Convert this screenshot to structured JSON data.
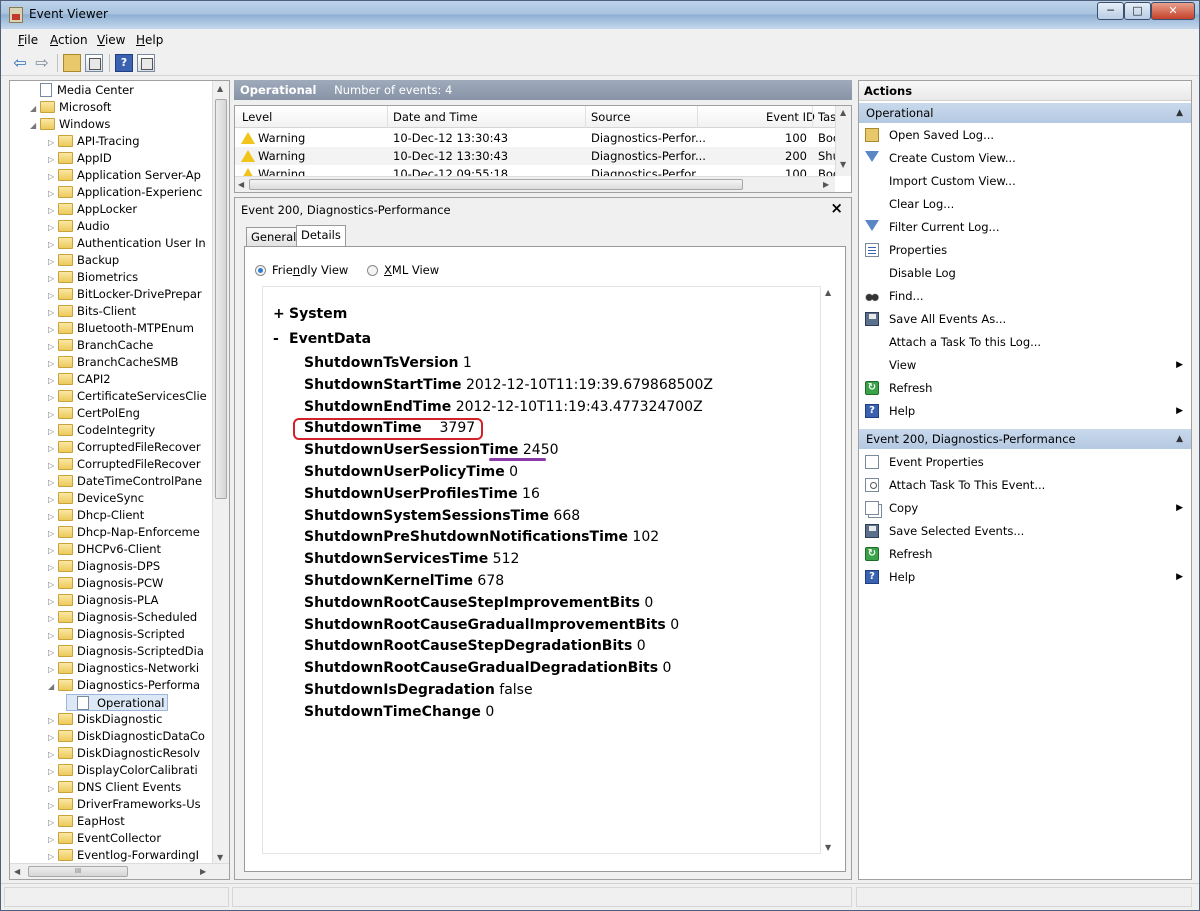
{
  "window": {
    "title": "Event Viewer",
    "min": "─",
    "max": "□",
    "close": "✕"
  },
  "menu": [
    {
      "underline": "F",
      "rest": "ile"
    },
    {
      "underline": "A",
      "rest": "ction"
    },
    {
      "underline": "V",
      "rest": "iew"
    },
    {
      "underline": "H",
      "rest": "elp"
    }
  ],
  "toolbar": {
    "back": "⇦",
    "forward": "⇨",
    "help": "?"
  },
  "tree": {
    "items": [
      {
        "label": "Media Center",
        "level": 0,
        "icon": "log",
        "expander": ""
      },
      {
        "label": "Microsoft",
        "level": 0,
        "icon": "folder",
        "expander": "◢"
      },
      {
        "label": "Windows",
        "level": 1,
        "icon": "folder",
        "expander": "◢"
      },
      {
        "label": "API-Tracing",
        "level": 2,
        "icon": "folder",
        "expander": "▷"
      },
      {
        "label": "AppID",
        "level": 2,
        "icon": "folder",
        "expander": "▷"
      },
      {
        "label": "Application Server-Ap",
        "level": 2,
        "icon": "folder",
        "expander": "▷"
      },
      {
        "label": "Application-Experienc",
        "level": 2,
        "icon": "folder",
        "expander": "▷"
      },
      {
        "label": "AppLocker",
        "level": 2,
        "icon": "folder",
        "expander": "▷"
      },
      {
        "label": "Audio",
        "level": 2,
        "icon": "folder",
        "expander": "▷"
      },
      {
        "label": "Authentication User In",
        "level": 2,
        "icon": "folder",
        "expander": "▷"
      },
      {
        "label": "Backup",
        "level": 2,
        "icon": "folder",
        "expander": "▷"
      },
      {
        "label": "Biometrics",
        "level": 2,
        "icon": "folder",
        "expander": "▷"
      },
      {
        "label": "BitLocker-DrivePrepar",
        "level": 2,
        "icon": "folder",
        "expander": "▷"
      },
      {
        "label": "Bits-Client",
        "level": 2,
        "icon": "folder",
        "expander": "▷"
      },
      {
        "label": "Bluetooth-MTPEnum",
        "level": 2,
        "icon": "folder",
        "expander": "▷"
      },
      {
        "label": "BranchCache",
        "level": 2,
        "icon": "folder",
        "expander": "▷"
      },
      {
        "label": "BranchCacheSMB",
        "level": 2,
        "icon": "folder",
        "expander": "▷"
      },
      {
        "label": "CAPI2",
        "level": 2,
        "icon": "folder",
        "expander": "▷"
      },
      {
        "label": "CertificateServicesClie",
        "level": 2,
        "icon": "folder",
        "expander": "▷"
      },
      {
        "label": "CertPolEng",
        "level": 2,
        "icon": "folder",
        "expander": "▷"
      },
      {
        "label": "CodeIntegrity",
        "level": 2,
        "icon": "folder",
        "expander": "▷"
      },
      {
        "label": "CorruptedFileRecover",
        "level": 2,
        "icon": "folder",
        "expander": "▷"
      },
      {
        "label": "CorruptedFileRecover",
        "level": 2,
        "icon": "folder",
        "expander": "▷"
      },
      {
        "label": "DateTimeControlPane",
        "level": 2,
        "icon": "folder",
        "expander": "▷"
      },
      {
        "label": "DeviceSync",
        "level": 2,
        "icon": "folder",
        "expander": "▷"
      },
      {
        "label": "Dhcp-Client",
        "level": 2,
        "icon": "folder",
        "expander": "▷"
      },
      {
        "label": "Dhcp-Nap-Enforceme",
        "level": 2,
        "icon": "folder",
        "expander": "▷"
      },
      {
        "label": "DHCPv6-Client",
        "level": 2,
        "icon": "folder",
        "expander": "▷"
      },
      {
        "label": "Diagnosis-DPS",
        "level": 2,
        "icon": "folder",
        "expander": "▷"
      },
      {
        "label": "Diagnosis-PCW",
        "level": 2,
        "icon": "folder",
        "expander": "▷"
      },
      {
        "label": "Diagnosis-PLA",
        "level": 2,
        "icon": "folder",
        "expander": "▷"
      },
      {
        "label": "Diagnosis-Scheduled",
        "level": 2,
        "icon": "folder",
        "expander": "▷"
      },
      {
        "label": "Diagnosis-Scripted",
        "level": 2,
        "icon": "folder",
        "expander": "▷"
      },
      {
        "label": "Diagnosis-ScriptedDia",
        "level": 2,
        "icon": "folder",
        "expander": "▷"
      },
      {
        "label": "Diagnostics-Networki",
        "level": 2,
        "icon": "folder",
        "expander": "▷"
      },
      {
        "label": "Diagnostics-Performa",
        "level": 2,
        "icon": "folder",
        "expander": "◢"
      },
      {
        "label": "Operational",
        "level": 3,
        "icon": "log",
        "expander": "",
        "selected": true
      },
      {
        "label": "DiskDiagnostic",
        "level": 2,
        "icon": "folder",
        "expander": "▷"
      },
      {
        "label": "DiskDiagnosticDataCo",
        "level": 2,
        "icon": "folder",
        "expander": "▷"
      },
      {
        "label": "DiskDiagnosticResolv",
        "level": 2,
        "icon": "folder",
        "expander": "▷"
      },
      {
        "label": "DisplayColorCalibrati",
        "level": 2,
        "icon": "folder",
        "expander": "▷"
      },
      {
        "label": "DNS Client Events",
        "level": 2,
        "icon": "folder",
        "expander": "▷"
      },
      {
        "label": "DriverFrameworks-Us",
        "level": 2,
        "icon": "folder",
        "expander": "▷"
      },
      {
        "label": "EapHost",
        "level": 2,
        "icon": "folder",
        "expander": "▷"
      },
      {
        "label": "EventCollector",
        "level": 2,
        "icon": "folder",
        "expander": "▷"
      },
      {
        "label": "Eventlog-ForwardingI",
        "level": 2,
        "icon": "folder",
        "expander": "▷"
      }
    ]
  },
  "log_header": {
    "name": "Operational",
    "count_text": "Number of events: 4"
  },
  "events": {
    "columns": [
      "Level",
      "Date and Time",
      "Source",
      "Event ID",
      "Tas"
    ],
    "rows": [
      {
        "level": "Warning",
        "datetime": "10-Dec-12 13:30:43",
        "source": "Diagnostics-Perfor...",
        "event_id": "100",
        "task": "Boo"
      },
      {
        "level": "Warning",
        "datetime": "10-Dec-12 13:30:43",
        "source": "Diagnostics-Perfor...",
        "event_id": "200",
        "task": "Shu"
      },
      {
        "level": "Warning",
        "datetime": "10-Dec-12 09:55:18",
        "source": "Diagnostics-Perfor...",
        "event_id": "100",
        "task": "Boo"
      }
    ]
  },
  "detail": {
    "title": "Event 200, Diagnostics-Performance",
    "close": "×",
    "tabs": [
      "General",
      "Details"
    ],
    "friendly_view": {
      "before": "Frie",
      "underline": "n",
      "after": "dly View"
    },
    "xml_view": {
      "underline": "X",
      "after": "ML View"
    },
    "system": {
      "toggle": "+",
      "label": "System"
    },
    "eventdata": {
      "toggle": "-",
      "label": "EventData"
    },
    "fields": [
      {
        "key": "ShutdownTsVersion",
        "value": "1"
      },
      {
        "key": "ShutdownStartTime",
        "value": "2012-12-10T11:19:39.679868500Z"
      },
      {
        "key": "ShutdownEndTime",
        "value": "2012-12-10T11:19:43.477324700Z"
      },
      {
        "key": "ShutdownTime",
        "value": "3797"
      },
      {
        "key": "ShutdownUserSessionTime",
        "value": "2450"
      },
      {
        "key": "ShutdownUserPolicyTime",
        "value": "0"
      },
      {
        "key": "ShutdownUserProfilesTime",
        "value": "16"
      },
      {
        "key": "ShutdownSystemSessionsTime",
        "value": "668"
      },
      {
        "key": "ShutdownPreShutdownNotificationsTime",
        "value": "102"
      },
      {
        "key": "ShutdownServicesTime",
        "value": "512"
      },
      {
        "key": "ShutdownKernelTime",
        "value": "678"
      },
      {
        "key": "ShutdownRootCauseStepImprovementBits",
        "value": "0"
      },
      {
        "key": "ShutdownRootCauseGradualImprovementBits",
        "value": "0"
      },
      {
        "key": "ShutdownRootCauseStepDegradationBits",
        "value": "0"
      },
      {
        "key": "ShutdownRootCauseGradualDegradationBits",
        "value": "0"
      },
      {
        "key": "ShutdownIsDegradation",
        "value": "false"
      },
      {
        "key": "ShutdownTimeChange",
        "value": "0"
      }
    ]
  },
  "actions": {
    "title": "Actions",
    "section1": {
      "label": "Operational",
      "items": [
        {
          "label": "Open Saved Log...",
          "icon": "folder-icon",
          "sub": false
        },
        {
          "label": "Create Custom View...",
          "icon": "filter-icon",
          "sub": false
        },
        {
          "label": "Import Custom View...",
          "icon": "",
          "sub": false
        },
        {
          "label": "Clear Log...",
          "icon": "",
          "sub": false
        },
        {
          "label": "Filter Current Log...",
          "icon": "filter-icon",
          "sub": false
        },
        {
          "label": "Properties",
          "icon": "properties-icon",
          "sub": false
        },
        {
          "label": "Disable Log",
          "icon": "",
          "sub": false
        },
        {
          "label": "Find...",
          "icon": "binoculars-icon",
          "sub": false
        },
        {
          "label": "Save All Events As...",
          "icon": "save-icon",
          "sub": false
        },
        {
          "label": "Attach a Task To this Log...",
          "icon": "",
          "sub": false
        },
        {
          "label": "View",
          "icon": "",
          "sub": true
        },
        {
          "label": "Refresh",
          "icon": "refresh-icon",
          "sub": false
        },
        {
          "label": "Help",
          "icon": "help-icon",
          "sub": true
        }
      ]
    },
    "section2": {
      "label": "Event 200, Diagnostics-Performance",
      "items": [
        {
          "label": "Event Properties",
          "icon": "event-properties-icon",
          "sub": false
        },
        {
          "label": "Attach Task To This Event...",
          "icon": "task-icon",
          "sub": false
        },
        {
          "label": "Copy",
          "icon": "copy-icon",
          "sub": true
        },
        {
          "label": "Save Selected Events...",
          "icon": "save-icon",
          "sub": false
        },
        {
          "label": "Refresh",
          "icon": "refresh-icon",
          "sub": false
        },
        {
          "label": "Help",
          "icon": "help-icon",
          "sub": true
        }
      ]
    }
  },
  "colors": {
    "section_header": "#b4c9e2",
    "log_header": "#8793a6",
    "highlight_box": "#d2232a",
    "underline_mark": "#8a3aa8",
    "warning": "#f0c419"
  }
}
